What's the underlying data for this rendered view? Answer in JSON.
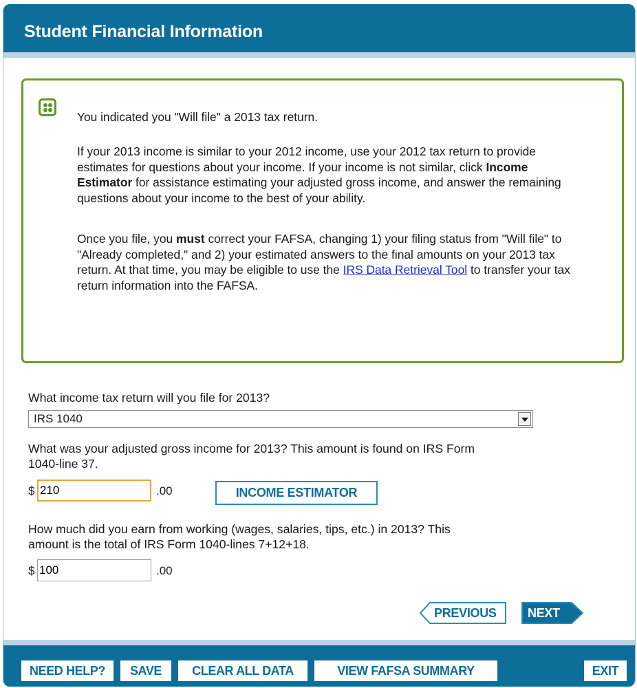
{
  "header": {
    "title": "Student Financial Information"
  },
  "notice": {
    "icon": "info-dots-icon",
    "line1": "You indicated you \"Will file\" a 2013 tax return.",
    "p2_a": "If your 2013 income is similar to your 2012 income, use your 2012 tax return to provide estimates for questions about your income. If your income is not similar, click ",
    "p2_bold": "Income Estimator",
    "p2_b": " for assistance estimating your adjusted gross income, and answer the remaining questions about your income to the best of your ability.",
    "p3_a": "Once you file, you ",
    "p3_bold": "must",
    "p3_b": " correct your FAFSA, changing 1) your filing status from \"Will file\" to \"Already completed,\" and 2) your estimated answers to the final amounts on your 2013 tax return. At that time, you may be eligible to use the ",
    "p3_link": "IRS Data Retrieval Tool",
    "p3_c": " to transfer your tax return information into the FAFSA."
  },
  "form": {
    "q1": {
      "label": "What income tax return will you file for 2013?",
      "selected": "IRS 1040"
    },
    "q2": {
      "label_line1": "What was your adjusted gross income for 2013? This amount is found on IRS Form",
      "label_line2": "1040-line 37.",
      "currency": "$",
      "value": "210",
      "cents": ".00",
      "estimator_label": "INCOME ESTIMATOR"
    },
    "q3": {
      "label_line1": "How much did you earn from working (wages, salaries, tips, etc.) in 2013? This",
      "label_line2": "amount is the total of IRS Form 1040-lines 7+12+18.",
      "currency": "$",
      "value": "100",
      "cents": ".00"
    }
  },
  "nav": {
    "previous": "PREVIOUS",
    "next": "NEXT"
  },
  "footer": {
    "need_help": "NEED HELP?",
    "save": "SAVE",
    "clear": "CLEAR ALL DATA",
    "summary": "VIEW FAFSA SUMMARY",
    "exit": "EXIT"
  },
  "colors": {
    "header": "#0e6e9a",
    "notice_border": "#6e9a2a",
    "focus_border": "#e6a63a",
    "link": "#1f2ec8"
  }
}
